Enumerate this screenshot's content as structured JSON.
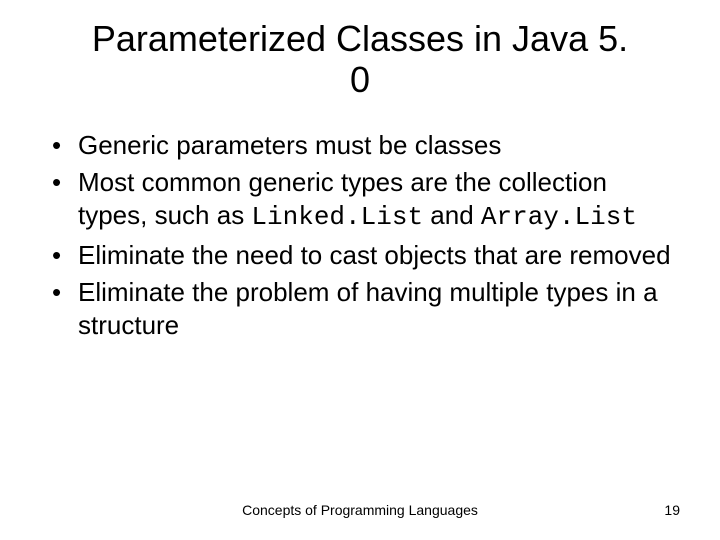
{
  "title": "Parameterized Classes in Java 5. 0",
  "bullets": [
    {
      "text": "Generic parameters must be classes"
    },
    {
      "pre": "Most common generic types are the collection types, such as ",
      "code1": "Linked.List",
      "mid": " and ",
      "code2": "Array.List"
    },
    {
      "text": "Eliminate the need to cast objects that are removed"
    },
    {
      "text": "Eliminate the problem of having multiple types in a structure"
    }
  ],
  "footer": "Concepts of Programming Languages",
  "page": "19"
}
